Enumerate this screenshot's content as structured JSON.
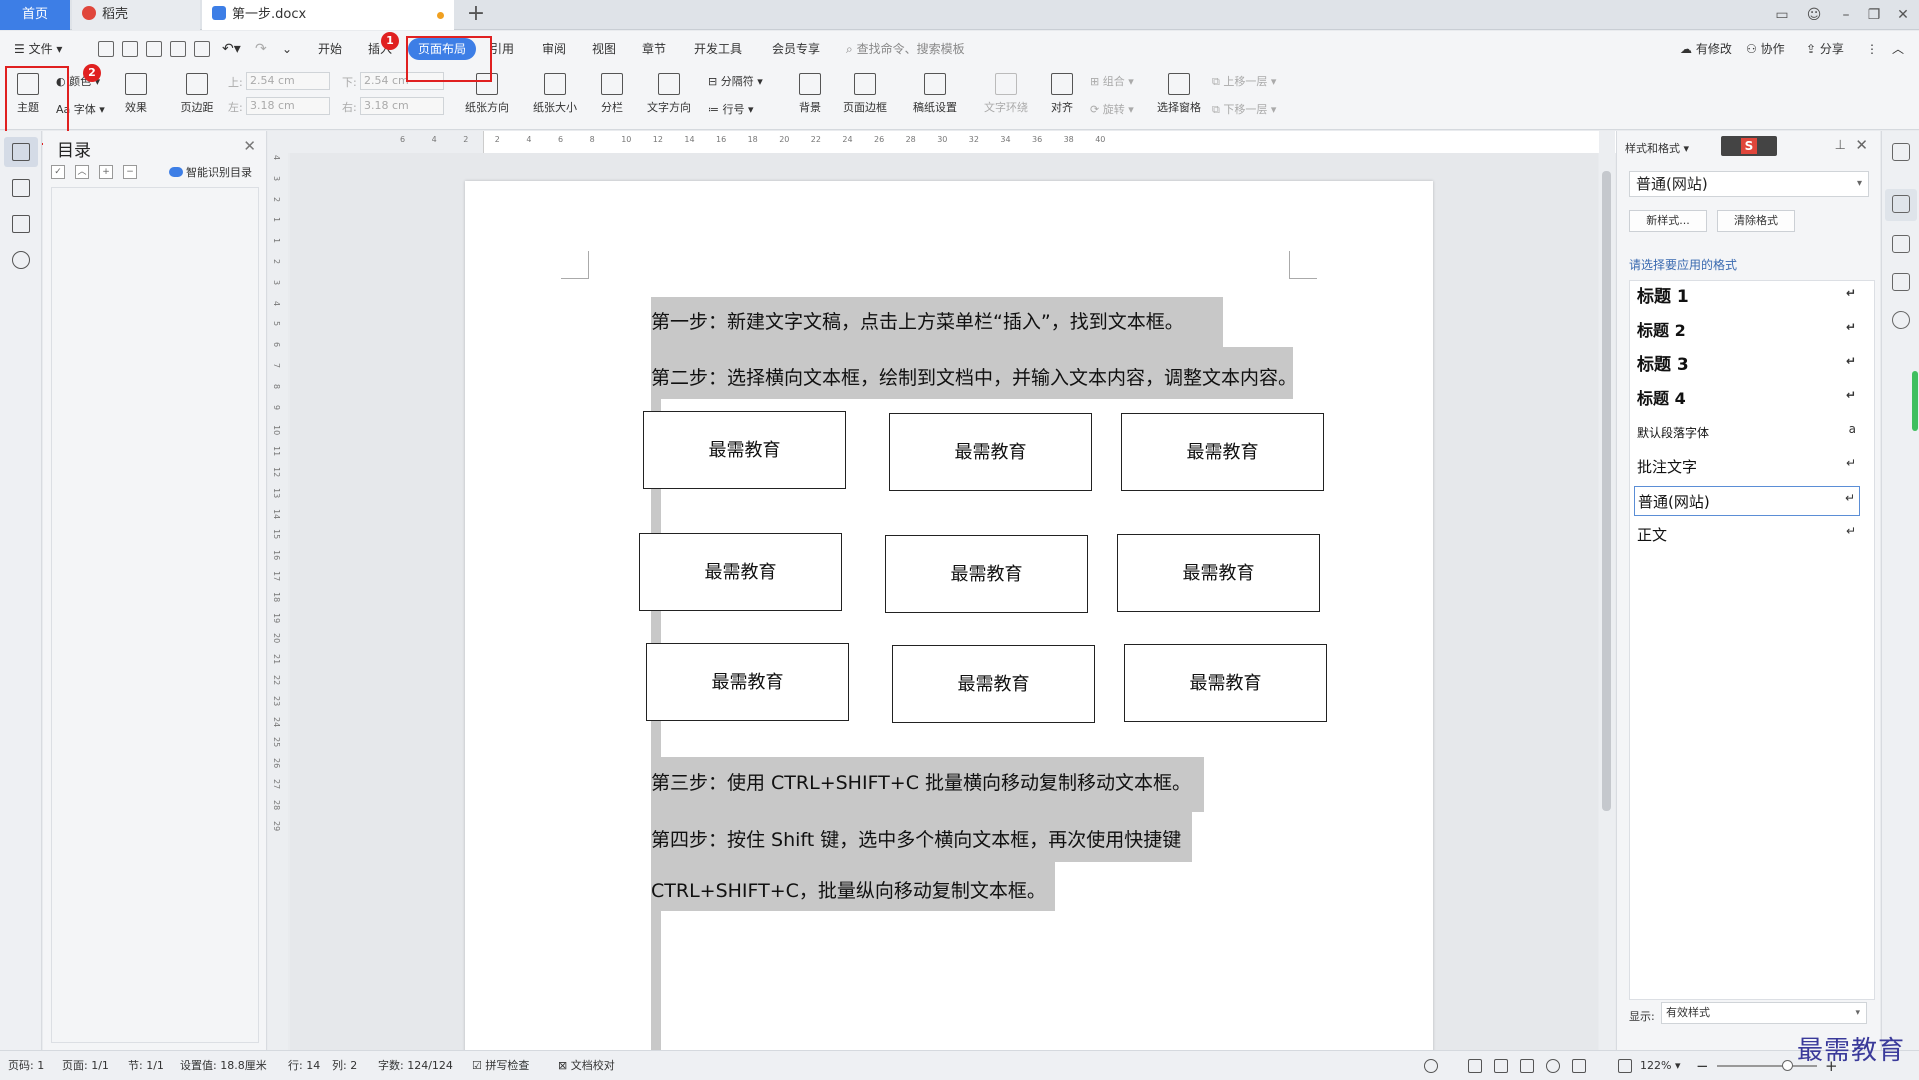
{
  "tabs": {
    "home": "首页",
    "daoke": "稻壳",
    "document": "第一步.docx",
    "add": "+"
  },
  "menu": {
    "file": "文件",
    "items": [
      "开始",
      "插入",
      "页面布局",
      "引用",
      "审阅",
      "视图",
      "章节",
      "开发工具",
      "会员专享"
    ],
    "search_placeholder": "查找命令、搜索模板",
    "modified": "有修改",
    "collaborate": "协作",
    "share": "分享"
  },
  "ribbon": {
    "theme": "主题",
    "colors": "颜色",
    "fonts": "字体",
    "effects": "效果",
    "margins": "页边距",
    "margin_top_label": "上:",
    "margin_top": "2.54 cm",
    "margin_left_label": "左:",
    "margin_left": "3.18 cm",
    "margin_bottom_label": "下:",
    "margin_bottom": "2.54 cm",
    "margin_right_label": "右:",
    "margin_right": "3.18 cm",
    "orientation": "纸张方向",
    "size": "纸张大小",
    "columns": "分栏",
    "text_direction": "文字方向",
    "separator": "分隔符",
    "line_numbers": "行号",
    "background": "背景",
    "page_border": "页面边框",
    "draft_settings": "稿纸设置",
    "text_wrap": "文字环绕",
    "align": "对齐",
    "group": "组合",
    "rotate": "旋转",
    "selection_pane": "选择窗格",
    "bring_forward": "上移一层",
    "send_backward": "下移一层"
  },
  "annotations": {
    "badge1": "1",
    "badge2": "2"
  },
  "toc": {
    "title": "目录",
    "smart": "智能识别目录"
  },
  "ruler": {
    "h_ticks": [
      "6",
      "4",
      "2",
      "2",
      "4",
      "6",
      "8",
      "10",
      "12",
      "14",
      "16",
      "18",
      "20",
      "22",
      "24",
      "26",
      "28",
      "30",
      "32",
      "34",
      "36",
      "38",
      "40"
    ],
    "v_ticks": [
      "4",
      "3",
      "2",
      "1",
      "1",
      "2",
      "3",
      "4",
      "5",
      "6",
      "7",
      "8",
      "9",
      "10",
      "11",
      "12",
      "13",
      "14",
      "15",
      "16",
      "17",
      "18",
      "19",
      "20",
      "21",
      "22",
      "23",
      "24",
      "25",
      "26",
      "27",
      "28",
      "29"
    ]
  },
  "document": {
    "step1": "第一步：新建文字文稿，点击上方菜单栏“插入”，找到文本框。",
    "step2": "第二步：选择横向文本框，绘制到文档中，并输入文本内容，调整文本内容。",
    "textbox_label": "最需教育",
    "step3": "第三步：使用 CTRL+SHIFT+C 批量横向移动复制移动文本框。",
    "step4_line1": "第四步：按住 Shift 键，选中多个横向文本框，再次使用快捷键",
    "step4_line2": "CTRL+SHIFT+C，批量纵向移动复制文本框。"
  },
  "styles_panel": {
    "title": "样式和格式",
    "current": "普通(网站)",
    "new_style": "新样式...",
    "clear_format": "清除格式",
    "hint": "请选择要应用的格式",
    "items": [
      "标题 1",
      "标题 2",
      "标题 3",
      "标题 4",
      "默认段落字体",
      "批注文字",
      "普通(网站)",
      "正文"
    ],
    "show_label": "显示:",
    "show_value": "有效样式"
  },
  "status": {
    "page_num": "页码: 1",
    "pages": "页面: 1/1",
    "section": "节: 1/1",
    "setting": "设置值: 18.8厘米",
    "row": "行: 14",
    "col": "列: 2",
    "words": "字数: 124/124",
    "spell": "拼写检查",
    "proof": "文档校对",
    "zoom": "122%"
  },
  "watermark": "最需教育"
}
